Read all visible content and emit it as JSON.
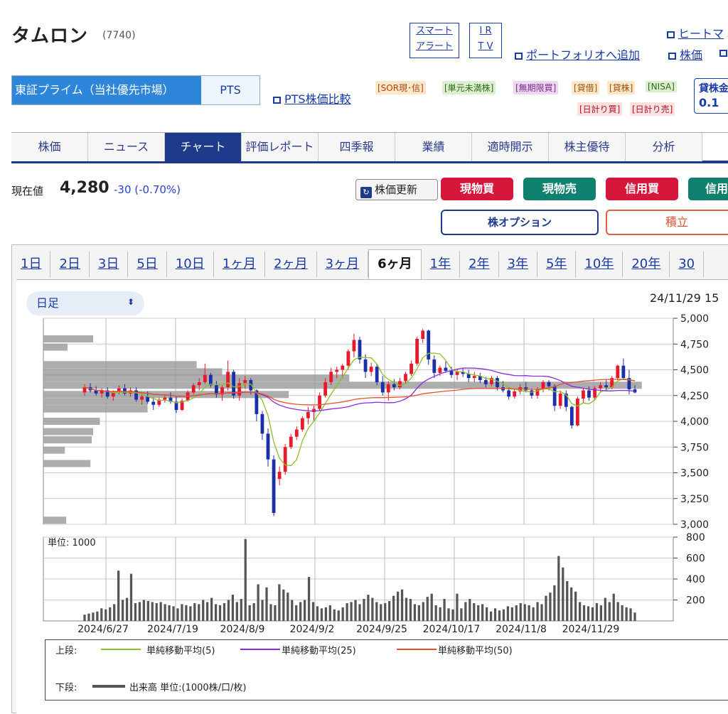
{
  "header": {
    "title": "タムロン",
    "code": "(7740)",
    "smart_alert": [
      "スマート",
      "アラート"
    ],
    "ir_tv": [
      "I R",
      "T V"
    ],
    "heatmap_link": "ヒートマ",
    "portfolio_link": "ポートフォリオへ追加",
    "kabuka_link": "株価"
  },
  "market": {
    "selected": "東証プライム（当社優先市場）",
    "pts": "PTS",
    "pts_compare": "PTS株価比較"
  },
  "tags": {
    "row1": [
      "[SOR現･信]",
      "[単元未満株]",
      "[無期限買]",
      "[貸借]",
      "[貸株]",
      "[NISA]"
    ],
    "row2": [
      "[日計り買]",
      "[日計り売]"
    ]
  },
  "lending": {
    "label": "貸株金",
    "value": "0.1"
  },
  "tabs": [
    "株価",
    "ニュース",
    "チャート",
    "評価レポート",
    "四季報",
    "業績",
    "適時開示",
    "株主優待",
    "分析"
  ],
  "quote": {
    "label": "現在値",
    "price": "4,280",
    "change": "-30 (-0.70%)"
  },
  "actions": {
    "refresh": "株価更新",
    "buttons": [
      {
        "label": "現物買",
        "color": "#d6173c"
      },
      {
        "label": "現物売",
        "color": "#12806e"
      },
      {
        "label": "信用買",
        "color": "#d6173c"
      },
      {
        "label": "信用",
        "color": "#12806e"
      }
    ],
    "option": "株オプション",
    "tsumitate": "積立"
  },
  "ranges": [
    "1日",
    "2日",
    "3日",
    "5日",
    "10日",
    "1ヶ月",
    "2ヶ月",
    "3ヶ月",
    "6ヶ月",
    "1年",
    "2年",
    "3年",
    "5年",
    "10年",
    "20年",
    "30"
  ],
  "active_range": "6ヶ月",
  "interval": "日足",
  "datetime": "24/11/29 15",
  "legend": {
    "upper_label": "上段:",
    "lower_label": "下段:",
    "sma5": "単純移動平均(5)",
    "sma25": "単純移動平均(25)",
    "sma50": "単純移動平均(50)",
    "volume": "出来高 単位:(1000株/口/枚)"
  },
  "chart_data": {
    "type": "candlestick",
    "price_ylim": [
      3000,
      5000
    ],
    "price_ticks": [
      "5,000",
      "4,750",
      "4,500",
      "4,250",
      "4,000",
      "3,750",
      "3,500",
      "3,250",
      "3,000"
    ],
    "volume_ylim": [
      0,
      800
    ],
    "volume_ticks": [
      "800",
      "600",
      "400",
      "200"
    ],
    "volume_unit": "単位: 1000",
    "x_labels": [
      "2024/6/27",
      "2024/7/19",
      "2024/8/9",
      "2024/9/2",
      "2024/9/25",
      "2024/10/17",
      "2024/11/8",
      "2024/11/29"
    ],
    "up_color": "#e8192c",
    "down_color": "#1a2fa8",
    "ohlc": [
      [
        4280,
        4360,
        4250,
        4330
      ],
      [
        4330,
        4370,
        4280,
        4300
      ],
      [
        4300,
        4340,
        4250,
        4270
      ],
      [
        4270,
        4320,
        4230,
        4300
      ],
      [
        4300,
        4330,
        4220,
        4240
      ],
      [
        4240,
        4300,
        4200,
        4280
      ],
      [
        4280,
        4350,
        4260,
        4320
      ],
      [
        4320,
        4360,
        4250,
        4270
      ],
      [
        4270,
        4330,
        4240,
        4300
      ],
      [
        4300,
        4330,
        4190,
        4210
      ],
      [
        4210,
        4260,
        4160,
        4240
      ],
      [
        4240,
        4290,
        4170,
        4190
      ],
      [
        4190,
        4230,
        4110,
        4160
      ],
      [
        4160,
        4230,
        4140,
        4210
      ],
      [
        4210,
        4260,
        4180,
        4230
      ],
      [
        4230,
        4280,
        4170,
        4190
      ],
      [
        4190,
        4240,
        4080,
        4110
      ],
      [
        4110,
        4220,
        4100,
        4200
      ],
      [
        4200,
        4300,
        4190,
        4280
      ],
      [
        4280,
        4370,
        4260,
        4350
      ],
      [
        4350,
        4420,
        4300,
        4380
      ],
      [
        4380,
        4560,
        4360,
        4450
      ],
      [
        4450,
        4470,
        4330,
        4350
      ],
      [
        4350,
        4390,
        4230,
        4260
      ],
      [
        4260,
        4350,
        4200,
        4330
      ],
      [
        4330,
        4590,
        4300,
        4480
      ],
      [
        4480,
        4500,
        4220,
        4250
      ],
      [
        4250,
        4420,
        4200,
        4370
      ],
      [
        4370,
        4440,
        4320,
        4400
      ],
      [
        4400,
        4420,
        4260,
        4300
      ],
      [
        4300,
        4310,
        4000,
        4070
      ],
      [
        4070,
        4100,
        3820,
        3880
      ],
      [
        3880,
        3930,
        3560,
        3630
      ],
      [
        3630,
        3670,
        3080,
        3110
      ],
      [
        3440,
        3560,
        3380,
        3510
      ],
      [
        3510,
        3780,
        3480,
        3750
      ],
      [
        3750,
        3880,
        3730,
        3850
      ],
      [
        3850,
        3950,
        3820,
        3920
      ],
      [
        3920,
        4050,
        3900,
        4030
      ],
      [
        4030,
        4140,
        3970,
        4090
      ],
      [
        4090,
        4150,
        4000,
        4120
      ],
      [
        4120,
        4280,
        4100,
        4250
      ],
      [
        4250,
        4420,
        4230,
        4380
      ],
      [
        4380,
        4520,
        4350,
        4480
      ],
      [
        4480,
        4530,
        4420,
        4500
      ],
      [
        4500,
        4560,
        4420,
        4540
      ],
      [
        4540,
        4700,
        4500,
        4680
      ],
      [
        4680,
        4850,
        4620,
        4790
      ],
      [
        4790,
        4820,
        4560,
        4600
      ],
      [
        4600,
        4650,
        4420,
        4480
      ],
      [
        4480,
        4570,
        4440,
        4530
      ],
      [
        4530,
        4560,
        4350,
        4380
      ],
      [
        4380,
        4440,
        4250,
        4280
      ],
      [
        4280,
        4390,
        4200,
        4360
      ],
      [
        4360,
        4410,
        4300,
        4330
      ],
      [
        4330,
        4420,
        4310,
        4390
      ],
      [
        4390,
        4480,
        4360,
        4460
      ],
      [
        4460,
        4590,
        4440,
        4560
      ],
      [
        4560,
        4820,
        4540,
        4800
      ],
      [
        4800,
        4900,
        4760,
        4880
      ],
      [
        4880,
        4890,
        4550,
        4600
      ],
      [
        4600,
        4640,
        4420,
        4470
      ],
      [
        4470,
        4540,
        4440,
        4520
      ],
      [
        4520,
        4580,
        4470,
        4490
      ],
      [
        4490,
        4530,
        4420,
        4450
      ],
      [
        4450,
        4510,
        4400,
        4480
      ],
      [
        4480,
        4520,
        4430,
        4460
      ],
      [
        4460,
        4500,
        4380,
        4420
      ],
      [
        4420,
        4480,
        4380,
        4440
      ],
      [
        4440,
        4470,
        4370,
        4400
      ],
      [
        4400,
        4430,
        4330,
        4360
      ],
      [
        4360,
        4440,
        4340,
        4420
      ],
      [
        4420,
        4440,
        4300,
        4330
      ],
      [
        4330,
        4390,
        4280,
        4300
      ],
      [
        4300,
        4330,
        4210,
        4240
      ],
      [
        4240,
        4310,
        4220,
        4290
      ],
      [
        4290,
        4360,
        4260,
        4330
      ],
      [
        4330,
        4380,
        4280,
        4300
      ],
      [
        4300,
        4320,
        4220,
        4250
      ],
      [
        4250,
        4330,
        4220,
        4310
      ],
      [
        4310,
        4400,
        4280,
        4380
      ],
      [
        4380,
        4400,
        4300,
        4340
      ],
      [
        4340,
        4360,
        4100,
        4150
      ],
      [
        4150,
        4300,
        4120,
        4270
      ],
      [
        4270,
        4300,
        4100,
        4140
      ],
      [
        4140,
        4150,
        3930,
        3960
      ],
      [
        3960,
        4240,
        3950,
        4220
      ],
      [
        4220,
        4320,
        4180,
        4300
      ],
      [
        4300,
        4340,
        4200,
        4230
      ],
      [
        4230,
        4340,
        4210,
        4320
      ],
      [
        4320,
        4380,
        4280,
        4350
      ],
      [
        4350,
        4400,
        4300,
        4330
      ],
      [
        4330,
        4440,
        4310,
        4420
      ],
      [
        4420,
        4550,
        4400,
        4540
      ],
      [
        4540,
        4610,
        4400,
        4420
      ],
      [
        4420,
        4500,
        4260,
        4310
      ],
      [
        4310,
        4350,
        4270,
        4280
      ]
    ],
    "volume": [
      60,
      70,
      80,
      90,
      120,
      110,
      130,
      160,
      480,
      200,
      220,
      450,
      170,
      180,
      200,
      190,
      180,
      170,
      180,
      160,
      150,
      140,
      120,
      160,
      150,
      140,
      170,
      160,
      200,
      180,
      220,
      160,
      150,
      170,
      200,
      250,
      180,
      210,
      780,
      150,
      170,
      350,
      200,
      320,
      160,
      150,
      350,
      300,
      270,
      200,
      150,
      180,
      200,
      420,
      180,
      140,
      120,
      130,
      150,
      110,
      100,
      130,
      170,
      180,
      200,
      160,
      210,
      250,
      220,
      180,
      160,
      170,
      190,
      240,
      280,
      300,
      220,
      210,
      160,
      150,
      180,
      230,
      260,
      150,
      130,
      210,
      120,
      110,
      260,
      120,
      180,
      210,
      170,
      150,
      160,
      130,
      90,
      120,
      100,
      110,
      140,
      130,
      150,
      170,
      160,
      150,
      130,
      180,
      160,
      240,
      270,
      340,
      620,
      510,
      380,
      320,
      280,
      180,
      150,
      140,
      130,
      170,
      150,
      220,
      180,
      260,
      180,
      150,
      130,
      120,
      80
    ],
    "volume_profile_bars": [
      {
        "price": 4800,
        "volume": 74
      },
      {
        "price": 4720,
        "volume": 36
      },
      {
        "price": 4550,
        "volume": 228
      },
      {
        "price": 4480,
        "volume": 266
      },
      {
        "price": 4420,
        "volume": 455
      },
      {
        "price": 4350,
        "volume": 890
      },
      {
        "price": 4260,
        "volume": 365
      },
      {
        "price": 4190,
        "volume": 155
      },
      {
        "price": 4120,
        "volume": 155
      },
      {
        "price": 4000,
        "volume": 84
      },
      {
        "price": 3900,
        "volume": 74
      },
      {
        "price": 3820,
        "volume": 72
      },
      {
        "price": 3720,
        "volume": 32
      },
      {
        "price": 3590,
        "volume": 70
      },
      {
        "price": 3040,
        "volume": 34
      }
    ],
    "series": [
      {
        "name": "単純移動平均(5)",
        "color": "#8cbf26"
      },
      {
        "name": "単純移動平均(25)",
        "color": "#8a2be2"
      },
      {
        "name": "単純移動平均(50)",
        "color": "#e8502c"
      }
    ]
  }
}
